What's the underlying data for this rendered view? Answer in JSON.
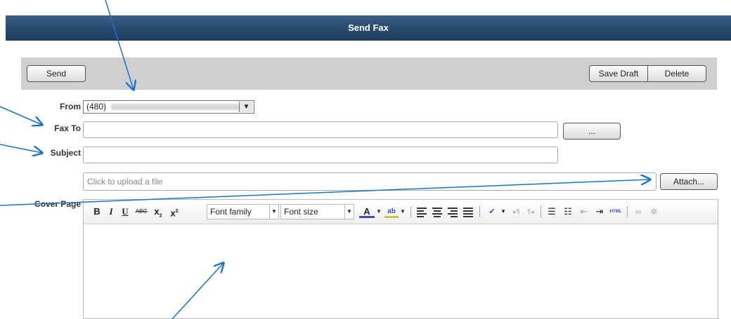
{
  "window": {
    "title": "Send Fax"
  },
  "toolbar": {
    "send_label": "Send",
    "save_draft_label": "Save Draft",
    "delete_label": "Delete"
  },
  "form": {
    "from_label": "From",
    "from_value": "(480)",
    "fax_to_label": "Fax To",
    "fax_to_value": "",
    "browse_label": "...",
    "subject_label": "Subject",
    "subject_value": "",
    "upload_placeholder": "Click to upload a file",
    "attach_label": "Attach...",
    "cover_page_label": "Cover Page"
  },
  "editor": {
    "font_family_label": "Font family",
    "font_size_label": "Font size",
    "bold": "B",
    "italic": "I",
    "underline": "U",
    "strike": "ABC",
    "subscript": "x",
    "superscript": "x",
    "html_label": "HTML"
  },
  "colors": {
    "titlebar": "#284a6e",
    "toolbar_bg": "#cfcfcf",
    "annotation_arrow": "#1a73c9"
  }
}
